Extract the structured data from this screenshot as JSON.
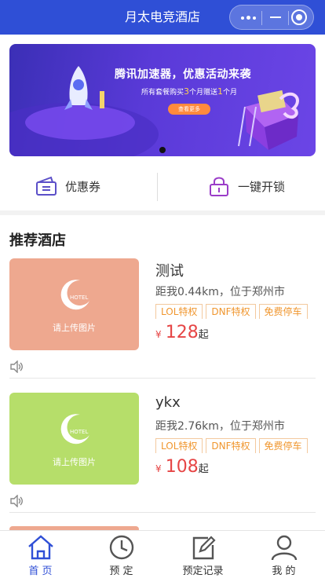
{
  "header": {
    "title": "月太电竞酒店"
  },
  "banner": {
    "headline": "腾讯加速器，优惠活动来袭",
    "sub_pre": "所有套餐购买",
    "sub_num1": "3",
    "sub_mid": "个月赠送",
    "sub_num2": "1",
    "sub_post": "个月",
    "cta": "查看更多"
  },
  "quick": {
    "coupon": "优惠券",
    "unlock": "一键开锁"
  },
  "section_title": "推荐酒店",
  "hotels": [
    {
      "name": "测试",
      "distance": "距我0.44km，位于郑州市",
      "tags": [
        "LOL特权",
        "DNF特权",
        "免费停车"
      ],
      "currency": "¥",
      "price": "128",
      "suffix": "起",
      "placeholder": "请上传图片",
      "logo_text": "HOTEL",
      "thumb_color": "#eea88f"
    },
    {
      "name": "ykx",
      "distance": "距我2.76km，位于郑州市",
      "tags": [
        "LOL特权",
        "DNF特权",
        "免费停车"
      ],
      "currency": "¥",
      "price": "108",
      "suffix": "起",
      "placeholder": "请上传图片",
      "logo_text": "HOTEL",
      "thumb_color": "#b6de6a"
    }
  ],
  "tabs": [
    {
      "label": "首 页",
      "icon": "home-icon",
      "active": true
    },
    {
      "label": "预 定",
      "icon": "clock-icon",
      "active": false
    },
    {
      "label": "预定记录",
      "icon": "edit-icon",
      "active": false
    },
    {
      "label": "我 的",
      "icon": "user-icon",
      "active": false
    }
  ],
  "colors": {
    "brand": "#2f4fd6",
    "price": "#e64545",
    "tag": "#f0962e"
  }
}
